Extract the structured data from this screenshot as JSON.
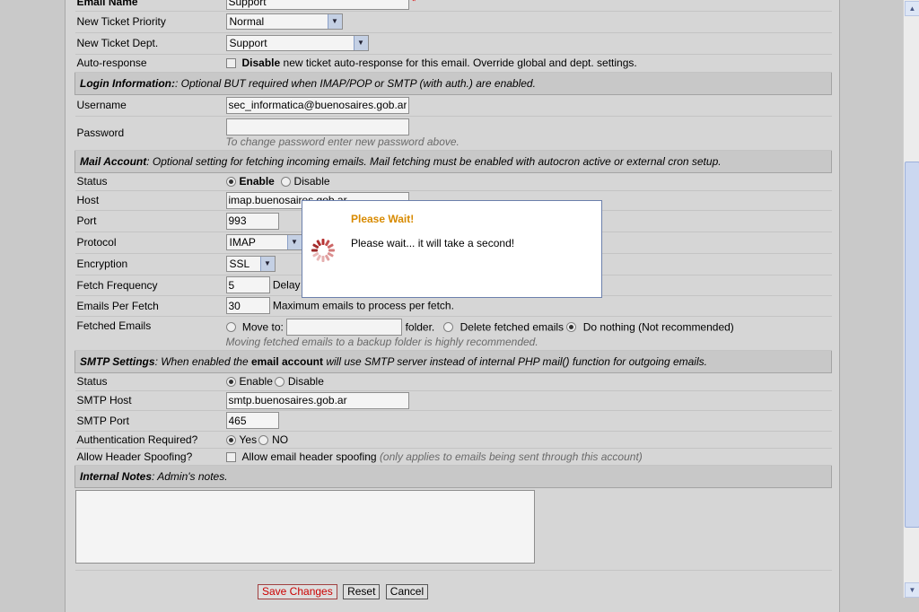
{
  "form": {
    "email_name_label": "Email Name",
    "email_name_value": "Support",
    "required_mark": "*",
    "priority_label": "New Ticket Priority",
    "priority_value": "Normal",
    "dept_label": "New Ticket Dept.",
    "dept_value": "Support",
    "autoresp_label": "Auto-response",
    "autoresp_bold": "Disable",
    "autoresp_text": "new ticket auto-response for this email. Override global and dept. settings.",
    "login_header_bold": "Login Information:",
    "login_header_text": ": Optional BUT required when IMAP/POP or SMTP (with auth.) are enabled.",
    "username_label": "Username",
    "username_value": "sec_informatica@buenosaires.gob.ar",
    "password_label": "Password",
    "password_note": "To change password enter new password above.",
    "mail_header_bold": "Mail Account",
    "mail_header_text": ": Optional setting for fetching incoming emails. Mail fetching must be enabled with autocron active or external cron setup.",
    "status_label": "Status",
    "status_enable": "Enable",
    "status_disable": "Disable",
    "host_label": "Host",
    "host_value": "imap.buenosaires.gob.ar",
    "port_label": "Port",
    "port_value": "993",
    "protocol_label": "Protocol",
    "protocol_value": "IMAP",
    "encryption_label": "Encryption",
    "encryption_value": "SSL",
    "freq_label": "Fetch Frequency",
    "freq_value": "5",
    "freq_text": "Delay",
    "perfetch_label": "Emails Per Fetch",
    "perfetch_value": "30",
    "perfetch_text": "Maximum emails to process per fetch.",
    "fetched_label": "Fetched Emails",
    "moveto_text": "Move to:",
    "folder_text": "folder.",
    "delete_text": "Delete fetched emails",
    "nothing_text": "Do nothing (Not recommended)",
    "fetched_note": "Moving fetched emails to a backup folder is highly recommended.",
    "smtp_header_bold": "SMTP Settings",
    "smtp_header_text1": ": When enabled the ",
    "smtp_header_bold2": "email account",
    "smtp_header_text2": " will use SMTP server instead of internal PHP mail() function for outgoing emails.",
    "smtp_status_label": "Status",
    "smtp_enable": "Enable",
    "smtp_disable": "Disable",
    "smtp_host_label": "SMTP Host",
    "smtp_host_value": "smtp.buenosaires.gob.ar",
    "smtp_port_label": "SMTP Port",
    "smtp_port_value": "465",
    "auth_label": "Authentication Required?",
    "auth_yes": "Yes",
    "auth_no": "NO",
    "spoof_label": "Allow Header Spoofing?",
    "spoof_text": "Allow email header spoofing",
    "spoof_note": "(only applies to emails being sent through this account)",
    "notes_header_bold": "Internal Notes",
    "notes_header_text": ": Admin's notes."
  },
  "buttons": {
    "save": "Save Changes",
    "reset": "Reset",
    "cancel": "Cancel"
  },
  "dialog": {
    "title": "Please Wait!",
    "message": "Please wait... it will take a second!"
  },
  "colors": {
    "dialog_title": "#d88a00",
    "required": "#dd0000"
  }
}
